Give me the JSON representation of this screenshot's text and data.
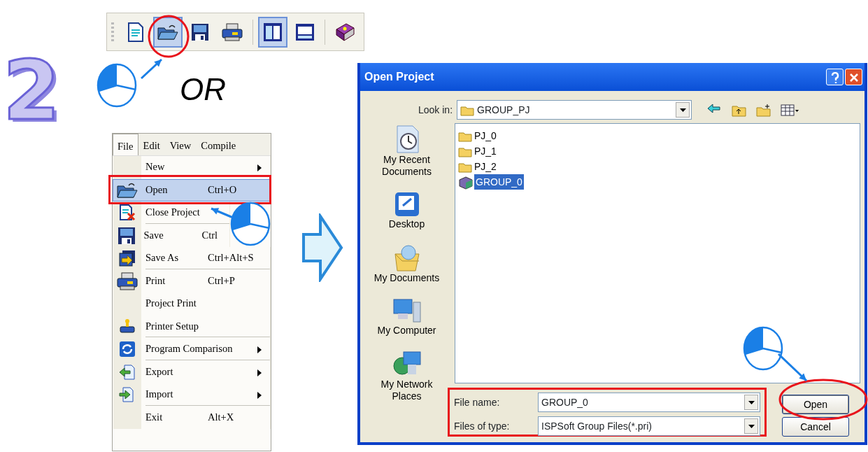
{
  "step_number": "2",
  "toolbar": {
    "buttons": [
      {
        "kind": "new",
        "selected": false
      },
      {
        "kind": "open",
        "selected": true
      },
      {
        "kind": "save",
        "selected": false
      },
      {
        "kind": "print",
        "selected": false
      },
      {
        "kind": "layout-split",
        "selected": true
      },
      {
        "kind": "layout-window",
        "selected": false
      },
      {
        "kind": "help",
        "selected": false
      }
    ]
  },
  "or_text": "OR",
  "menu": {
    "bar": [
      {
        "label": "File",
        "selected": true
      },
      {
        "label": "Edit",
        "selected": false
      },
      {
        "label": "View",
        "selected": false
      },
      {
        "label": "Compile",
        "selected": false
      }
    ],
    "items": [
      {
        "label": "New",
        "kind": "plain",
        "submenu": true,
        "selected": false,
        "separator_after": false
      },
      {
        "label": "Open",
        "shortcut": "Ctrl+O",
        "kind": "open",
        "submenu": false,
        "selected": true,
        "separator_after": false
      },
      {
        "label": "Close Project",
        "kind": "close-project",
        "submenu": false,
        "selected": false,
        "separator_after": true
      },
      {
        "label": "Save",
        "shortcut": "Ctrl",
        "kind": "save",
        "selected": false,
        "separator_after": false
      },
      {
        "label": "Save As",
        "shortcut": "Ctrl+Alt+S",
        "kind": "save-as",
        "submenu": false,
        "selected": false,
        "separator_after": true
      },
      {
        "label": "Print",
        "shortcut": "Ctrl+P",
        "kind": "print",
        "submenu": false,
        "selected": false,
        "separator_after": false
      },
      {
        "label": "Project Print",
        "kind": "plain",
        "submenu": false,
        "selected": false,
        "separator_after": false
      },
      {
        "label": "Printer Setup",
        "kind": "printer-setup",
        "submenu": false,
        "selected": false,
        "separator_after": true
      },
      {
        "label": "Program Comparison",
        "kind": "compare",
        "submenu": true,
        "selected": false,
        "separator_after": true
      },
      {
        "label": "Export",
        "kind": "export",
        "submenu": true,
        "selected": false,
        "separator_after": false
      },
      {
        "label": "Import",
        "kind": "import",
        "submenu": true,
        "selected": false,
        "separator_after": true
      },
      {
        "label": "Exit",
        "shortcut": "Alt+X",
        "kind": "plain",
        "submenu": false,
        "selected": false,
        "separator_after": false
      }
    ]
  },
  "dialog": {
    "title": "Open Project",
    "look_in_label": "Look in:",
    "look_in_value": "GROUP_PJ",
    "places": [
      {
        "label": "My Recent Documents",
        "kind": "recent"
      },
      {
        "label": "Desktop",
        "kind": "desktop"
      },
      {
        "label": "My Documents",
        "kind": "documents"
      },
      {
        "label": "My Computer",
        "kind": "computer"
      },
      {
        "label": "My Network Places",
        "kind": "network"
      }
    ],
    "files": [
      {
        "name": "PJ_0",
        "kind": "folder",
        "selected": false
      },
      {
        "name": "PJ_1",
        "kind": "folder",
        "selected": false
      },
      {
        "name": "PJ_2",
        "kind": "folder",
        "selected": false
      },
      {
        "name": "GROUP_0",
        "kind": "group",
        "selected": true
      }
    ],
    "file_name_label": "File name:",
    "file_name_value": "GROUP_0",
    "file_type_label": "Files of type:",
    "file_type_value": "ISPSoft Group Files(*.pri)",
    "buttons": [
      {
        "label": "Open",
        "kind": "default"
      },
      {
        "label": "Cancel",
        "kind": "normal"
      }
    ]
  }
}
